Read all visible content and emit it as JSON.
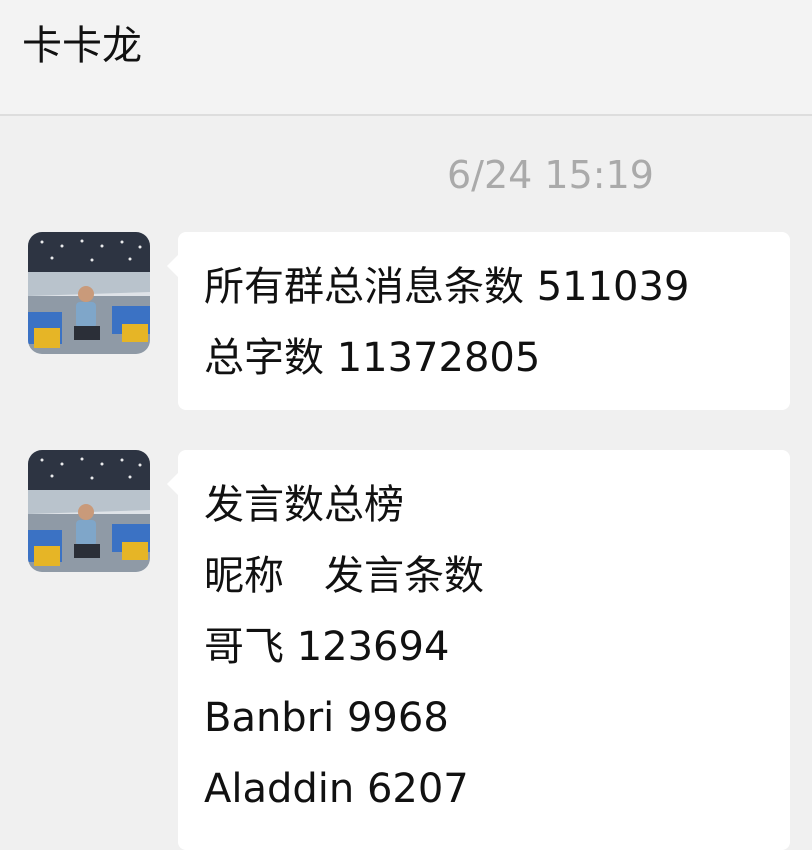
{
  "header": {
    "title": "卡卡龙"
  },
  "timestamp": "6/24 15:19",
  "messages": [
    {
      "lines": [
        "所有群总消息条数 511039",
        "总字数 11372805"
      ]
    },
    {
      "lines": [
        "发言数总榜",
        "昵称　发言条数",
        "哥飞 123694",
        "Banbri 9968",
        "Aladdin 6207"
      ]
    }
  ],
  "colors": {
    "background": "#f0f0f0",
    "bubble": "#ffffff",
    "timestamp": "#aaaaaa"
  }
}
